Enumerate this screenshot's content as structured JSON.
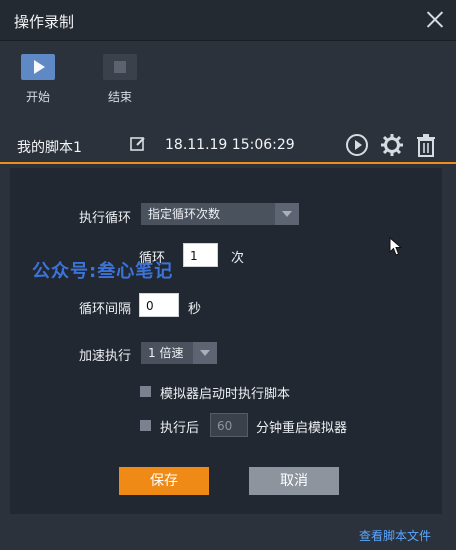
{
  "window": {
    "title": "操作录制"
  },
  "toolbar": {
    "start_label": "开始",
    "stop_label": "结束"
  },
  "script": {
    "name": "我的脚本1",
    "datetime": "18.11.19 15:06:29"
  },
  "settings": {
    "loop_label": "执行循环",
    "loop_mode": "指定循环次数",
    "loop_count_label": "循环",
    "loop_count_value": "1",
    "loop_count_unit": "次",
    "interval_label": "循环间隔",
    "interval_value": "0",
    "interval_unit": "秒",
    "speed_label": "加速执行",
    "speed_value": "1 倍速",
    "opt1_label": "模拟器启动时执行脚本",
    "opt2_prefix": "执行后",
    "opt2_value": "60",
    "opt2_suffix": "分钟重启模拟器"
  },
  "buttons": {
    "save": "保存",
    "cancel": "取消"
  },
  "footer": {
    "view_files": "查看脚本文件"
  },
  "watermark": "公众号:叁心笔记",
  "colors": {
    "accent": "#f08a17",
    "link": "#5aa7ff",
    "start_button": "#5f89c5"
  }
}
